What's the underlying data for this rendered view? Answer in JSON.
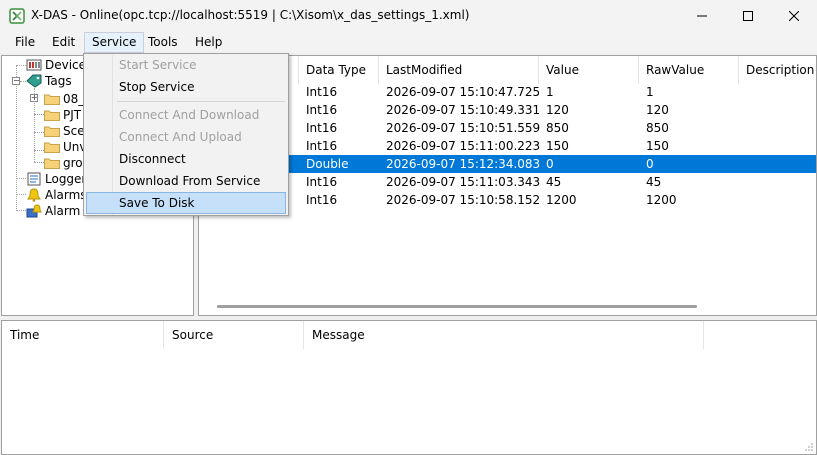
{
  "window": {
    "title": "X-DAS - Online(opc.tcp://localhost:5519 | C:\\Xisom\\x_das_settings_1.xml)",
    "controls": {
      "minimize": "minimize",
      "maximize": "maximize",
      "close": "close"
    }
  },
  "menubar": {
    "items": [
      "File",
      "Edit",
      "Service",
      "Tools",
      "Help"
    ],
    "active": "Service"
  },
  "service_menu": {
    "items": [
      {
        "label": "Start Service",
        "enabled": false
      },
      {
        "label": "Stop Service",
        "enabled": true
      },
      {
        "label": "Connect And Download",
        "enabled": false
      },
      {
        "label": "Connect And Upload",
        "enabled": false
      },
      {
        "label": "Disconnect",
        "enabled": true
      },
      {
        "label": "Download From Service",
        "enabled": true
      },
      {
        "label": "Save To Disk",
        "enabled": true,
        "highlighted": true
      }
    ]
  },
  "tree": {
    "items": [
      {
        "label": "Devices",
        "icon": "devices-icon"
      },
      {
        "label": "Tags",
        "icon": "tags-icon"
      },
      {
        "label": "08_",
        "icon": "folder-icon"
      },
      {
        "label": "PJT",
        "icon": "folder-icon"
      },
      {
        "label": "Sce",
        "icon": "folder-icon"
      },
      {
        "label": "Unv",
        "icon": "folder-icon"
      },
      {
        "label": "gro",
        "icon": "folder-icon"
      },
      {
        "label": "Logger",
        "icon": "logger-icon"
      },
      {
        "label": "Alarms",
        "icon": "alarm-bell-icon"
      },
      {
        "label": "Alarm L",
        "icon": "alarm-log-icon"
      }
    ]
  },
  "grid": {
    "columns": [
      "Data Type",
      "LastModified",
      "Value",
      "RawValue",
      "Description"
    ],
    "rows": [
      {
        "type": "Int16",
        "modified": "2026-09-07 15:10:47.725",
        "value": "1",
        "raw": "1"
      },
      {
        "type": "Int16",
        "modified": "2026-09-07 15:10:49.331",
        "value": "120",
        "raw": "120"
      },
      {
        "type": "Int16",
        "modified": "2026-09-07 15:10:51.559",
        "value": "850",
        "raw": "850"
      },
      {
        "type": "Int16",
        "modified": "2026-09-07 15:11:00.223",
        "value": "150",
        "raw": "150"
      },
      {
        "type": "Double",
        "modified": "2026-09-07 15:12:34.083",
        "value": "0",
        "raw": "0",
        "selected": true
      },
      {
        "type": "Int16",
        "modified": "2026-09-07 15:11:03.343",
        "value": "45",
        "raw": "45"
      },
      {
        "type": "Int16",
        "modified": "2026-09-07 15:10:58.152",
        "value": "1200",
        "raw": "1200"
      }
    ]
  },
  "log": {
    "columns": [
      "Time",
      "Source",
      "Message"
    ]
  },
  "colors": {
    "selection": "#0078d7",
    "menu_highlight": "#c5e0f8",
    "disabled_text": "#a0a0a0"
  }
}
